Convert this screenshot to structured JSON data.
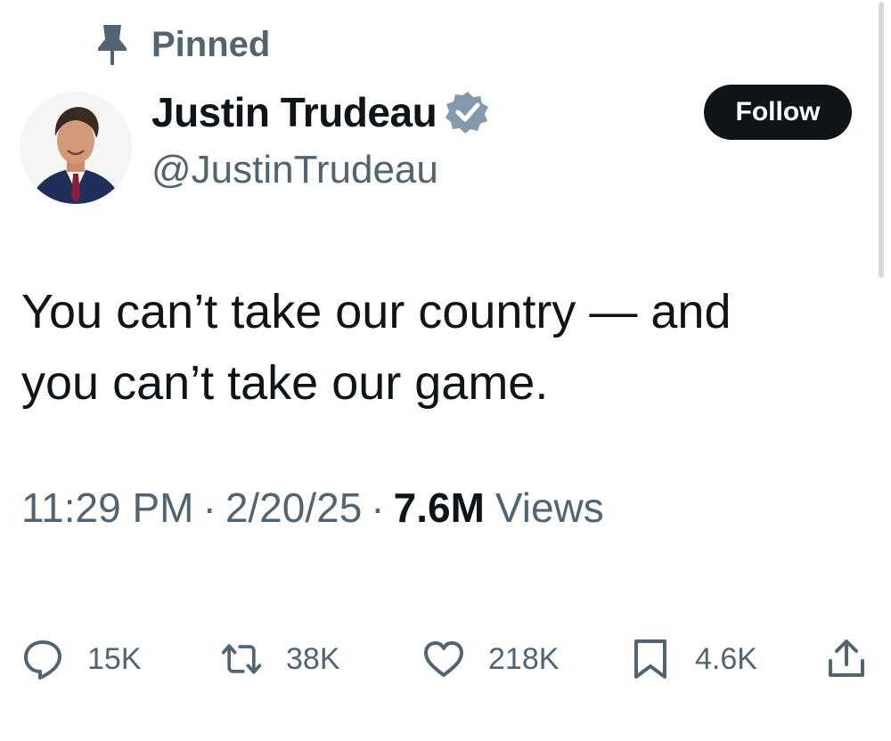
{
  "pinned_label": "Pinned",
  "author": {
    "name": "Justin Trudeau",
    "handle": "@JustinTrudeau",
    "verified": true
  },
  "follow_label": "Follow",
  "tweet": {
    "line1": "You can’t take our country — and",
    "line2": "you can’t take our game."
  },
  "meta": {
    "time": "11:29 PM",
    "date": "2/20/25",
    "separator": "·",
    "views_count": "7.6M",
    "views_label": "Views"
  },
  "actions": {
    "replies": "15K",
    "reposts": "38K",
    "likes": "218K",
    "bookmarks": "4.6K"
  },
  "colors": {
    "text": "#0f1419",
    "secondary": "#536471",
    "follow_bg": "#0f1419",
    "verified": "#829aab"
  },
  "icons": {
    "pinned": "pin-icon",
    "verified": "verified-badge-icon",
    "reply": "reply-icon",
    "repost": "repost-icon",
    "like": "like-icon",
    "bookmark": "bookmark-icon",
    "share": "share-icon"
  }
}
